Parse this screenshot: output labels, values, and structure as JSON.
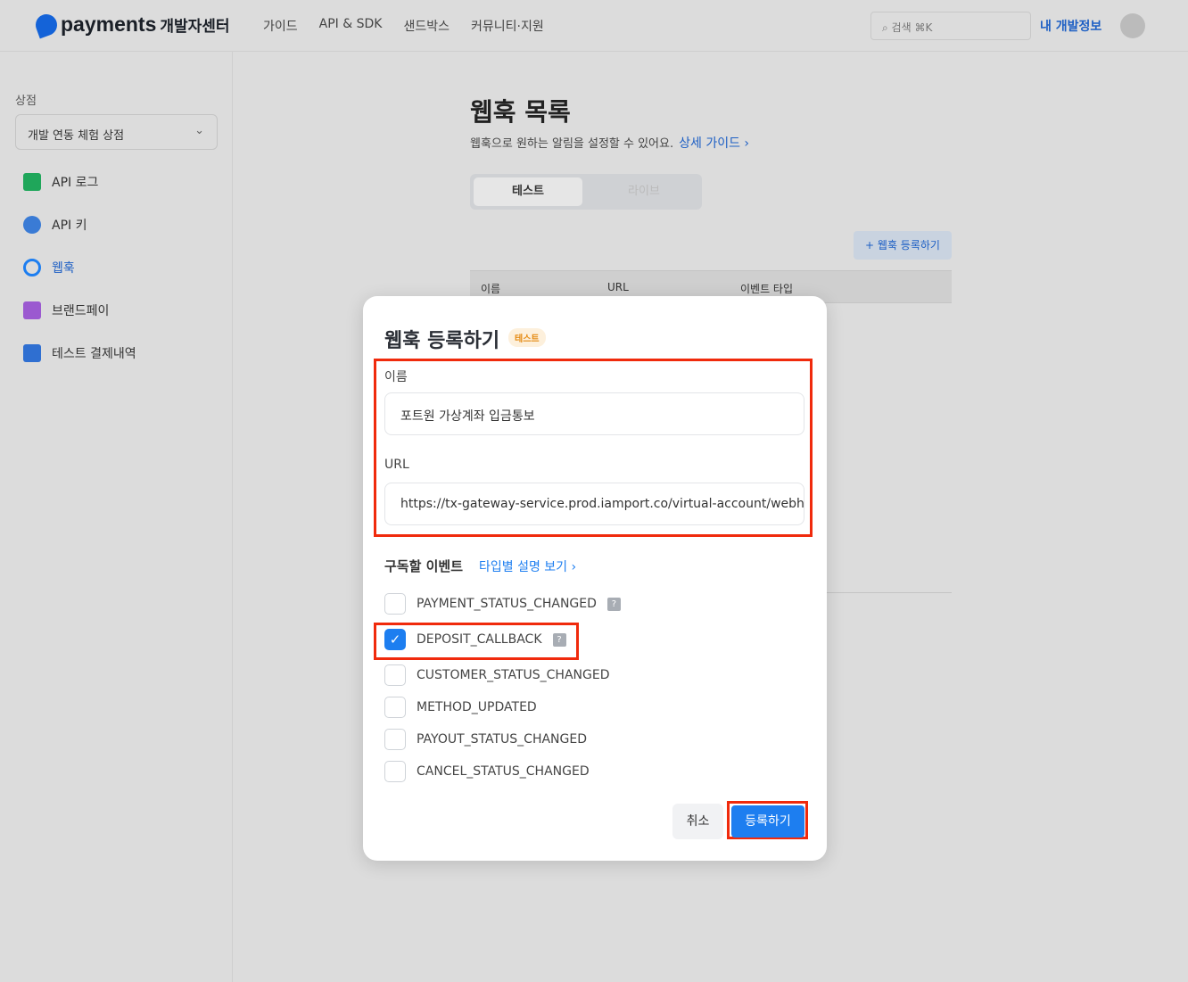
{
  "header": {
    "logo_text": "payments",
    "logo_sub": "개발자센터",
    "nav": [
      "가이드",
      "API & SDK",
      "샌드박스",
      "커뮤니티·지원"
    ],
    "search_placeholder": "검색 ⌘K",
    "my_info": "내 개발정보"
  },
  "sidebar": {
    "store_label": "상점",
    "store_value": "개발 연동 체험 상점",
    "items": [
      {
        "label": "API 로그",
        "icon": "log-icon",
        "color": "#1fa65a"
      },
      {
        "label": "API 키",
        "icon": "key-icon",
        "color": "#3a7bd5"
      },
      {
        "label": "웹훅",
        "icon": "sync-icon",
        "color": "#1d7ef0"
      },
      {
        "label": "브랜드페이",
        "icon": "brandpay-icon",
        "color": "#9b59d0"
      },
      {
        "label": "테스트 결제내역",
        "icon": "receipt-icon",
        "color": "#2f6fd1"
      }
    ]
  },
  "main": {
    "title": "웹훅 목록",
    "subtitle": "웹훅으로 원하는 알림을 설정할 수 있어요.",
    "guide_link": "상세 가이드 ›",
    "tabs": [
      "테스트",
      "라이브"
    ],
    "add_button": "+ 웹훅 등록하기",
    "columns": [
      "이름",
      "URL",
      "이벤트 타입"
    ]
  },
  "modal": {
    "title": "웹훅 등록하기",
    "badge": "테스트",
    "name_label": "이름",
    "name_value": "포트원 가상계좌 입금통보",
    "url_label": "URL",
    "url_value": "https://tx-gateway-service.prod.iamport.co/virtual-account/webhook",
    "events_label": "구독할 이벤트",
    "events_link": "타입별 설명 보기 ›",
    "events": [
      {
        "label": "PAYMENT_STATUS_CHANGED",
        "checked": false,
        "help": true
      },
      {
        "label": "DEPOSIT_CALLBACK",
        "checked": true,
        "help": true
      },
      {
        "label": "CUSTOMER_STATUS_CHANGED",
        "checked": false,
        "help": false
      },
      {
        "label": "METHOD_UPDATED",
        "checked": false,
        "help": false
      },
      {
        "label": "PAYOUT_STATUS_CHANGED",
        "checked": false,
        "help": false
      },
      {
        "label": "CANCEL_STATUS_CHANGED",
        "checked": false,
        "help": false
      }
    ],
    "cancel": "취소",
    "submit": "등록하기",
    "help_glyph": "?"
  },
  "colors": {
    "accent": "#1d7ef0",
    "highlight": "#f02a0c"
  }
}
